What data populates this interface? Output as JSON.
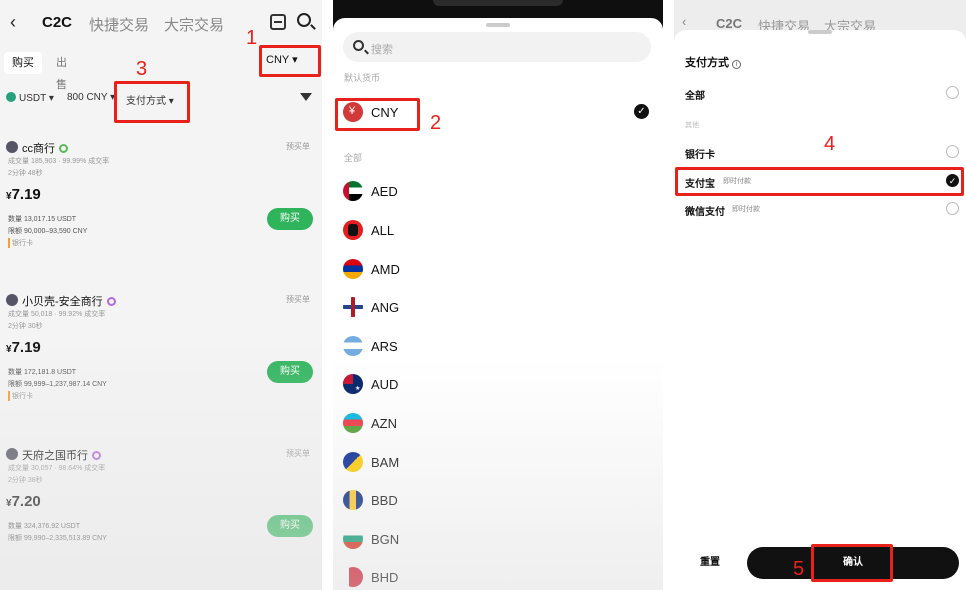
{
  "panel1": {
    "tabs": [
      "C2C",
      "快捷交易",
      "大宗交易"
    ],
    "segment": {
      "buy": "购买",
      "sell": "出售"
    },
    "currency_button": "CNY ▾",
    "filters": {
      "asset": "USDT ▾",
      "amount": "800 CNY ▾",
      "payment": "支付方式 ▾"
    },
    "merchants": [
      {
        "name": "cc商行",
        "tag": "预买单",
        "stats": "成交量 185,903 · 99.99% 成交率",
        "time": "2分钟 48秒",
        "price_prefix": "¥",
        "price": "7.19",
        "amount": "数量 13,017.15 USDT",
        "limit": "限额 90,000–93,590 CNY",
        "payment": "银行卡",
        "buy_label": "购买"
      },
      {
        "name": "小贝壳-安全商行",
        "tag": "预买单",
        "stats": "成交量 50,018 · 99.92% 成交率",
        "time": "2分钟 30秒",
        "price_prefix": "¥",
        "price": "7.19",
        "amount": "数量 172,181.8 USDT",
        "limit": "限额 99,999–1,237,987.14 CNY",
        "payment": "银行卡",
        "buy_label": "购买"
      },
      {
        "name": "天府之国币行",
        "tag": "预买单",
        "stats": "成交量 30,057 · 98.64% 成交率",
        "time": "2分钟 38秒",
        "price_prefix": "¥",
        "price": "7.20",
        "amount": "数量 324,376.92 USDT",
        "limit": "限额 99,990–2,335,513.89 CNY",
        "payment": "银行卡",
        "buy_label": "购买"
      }
    ]
  },
  "panel2": {
    "search_placeholder": "搜索",
    "default_label": "默认货币",
    "selected_currency": "CNY",
    "all_label": "全部",
    "currencies": [
      "AED",
      "ALL",
      "AMD",
      "ANG",
      "ARS",
      "AUD",
      "AZN",
      "BAM",
      "BBD",
      "BGN",
      "BHD"
    ]
  },
  "panel3": {
    "header_tabs": [
      "C2C",
      "快捷交易",
      "大宗交易"
    ],
    "title": "支付方式",
    "all_option": "全部",
    "other_label": "其他",
    "options": [
      {
        "label": "银行卡",
        "sub": "",
        "selected": false
      },
      {
        "label": "支付宝",
        "sub": "即时付款",
        "selected": true
      },
      {
        "label": "微信支付",
        "sub": "即时付款",
        "selected": false
      }
    ],
    "reset_label": "重置",
    "confirm_label": "确认"
  },
  "annotations": [
    "1",
    "2",
    "3",
    "4",
    "5"
  ],
  "colors": {
    "accent_red": "#e8211b",
    "buy_green": "#2fb45c",
    "usdt_green": "#26a17b"
  }
}
